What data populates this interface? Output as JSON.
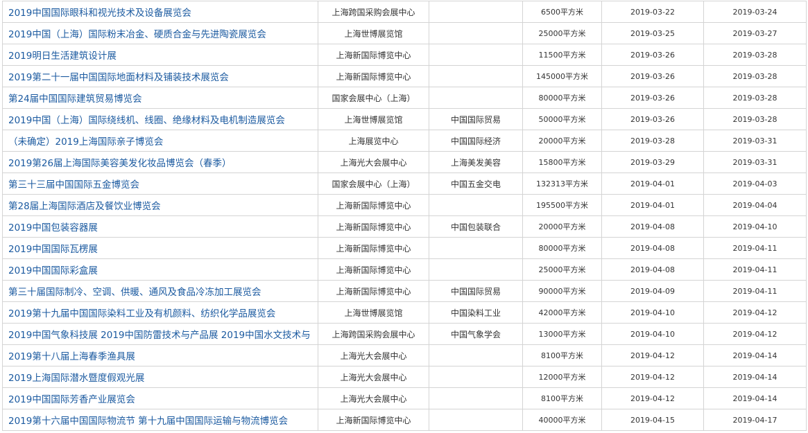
{
  "exhibitions": [
    {
      "name": "2019中国国际眼科和视光技术及设备展览会",
      "venue": "上海跨国采购会展中心",
      "organizer": "",
      "area": "6500平方米",
      "start": "2019-03-22",
      "end": "2019-03-24"
    },
    {
      "name": "2019中国（上海）国际粉末冶金、硬质合金与先进陶瓷展览会",
      "venue": "上海世博展览馆",
      "organizer": "",
      "area": "25000平方米",
      "start": "2019-03-25",
      "end": "2019-03-27"
    },
    {
      "name": "2019明日生活建筑设计展",
      "venue": "上海新国际博览中心",
      "organizer": "",
      "area": "11500平方米",
      "start": "2019-03-26",
      "end": "2019-03-28"
    },
    {
      "name": "2019第二十一届中国国际地面材料及铺装技术展览会",
      "venue": "上海新国际博览中心",
      "organizer": "",
      "area": "145000平方米",
      "start": "2019-03-26",
      "end": "2019-03-28"
    },
    {
      "name": "第24届中国国际建筑贸易博览会",
      "venue": "国家会展中心（上海）",
      "organizer": "",
      "area": "80000平方米",
      "start": "2019-03-26",
      "end": "2019-03-28"
    },
    {
      "name": "2019中国（上海）国际绕线机、线圈、绝缘材料及电机制造展览会",
      "venue": "上海世博展览馆",
      "organizer": "中国国际贸易",
      "area": "50000平方米",
      "start": "2019-03-26",
      "end": "2019-03-28"
    },
    {
      "name": "（未确定）2019上海国际亲子博览会",
      "venue": "上海展览中心",
      "organizer": "中国国际经济",
      "area": "20000平方米",
      "start": "2019-03-28",
      "end": "2019-03-31"
    },
    {
      "name": "2019第26届上海国际美容美发化妆品博览会（春季）",
      "venue": "上海光大会展中心",
      "organizer": "上海美发美容",
      "area": "15800平方米",
      "start": "2019-03-29",
      "end": "2019-03-31"
    },
    {
      "name": "第三十三届中国国际五金博览会",
      "venue": "国家会展中心（上海）",
      "organizer": "中国五金交电",
      "area": "132313平方米",
      "start": "2019-04-01",
      "end": "2019-04-03"
    },
    {
      "name": "第28届上海国际酒店及餐饮业博览会",
      "venue": "上海新国际博览中心",
      "organizer": "",
      "area": "195500平方米",
      "start": "2019-04-01",
      "end": "2019-04-04"
    },
    {
      "name": "2019中国包装容器展",
      "venue": "上海新国际博览中心",
      "organizer": "中国包装联合",
      "area": "20000平方米",
      "start": "2019-04-08",
      "end": "2019-04-10"
    },
    {
      "name": "2019中国国际瓦楞展",
      "venue": "上海新国际博览中心",
      "organizer": "",
      "area": "80000平方米",
      "start": "2019-04-08",
      "end": "2019-04-11"
    },
    {
      "name": "2019中国国际彩盒展",
      "venue": "上海新国际博览中心",
      "organizer": "",
      "area": "25000平方米",
      "start": "2019-04-08",
      "end": "2019-04-11"
    },
    {
      "name": "第三十届国际制冷、空调、供暖、通风及食品冷冻加工展览会",
      "venue": "上海新国际博览中心",
      "organizer": "中国国际贸易",
      "area": "90000平方米",
      "start": "2019-04-09",
      "end": "2019-04-11"
    },
    {
      "name": "2019第十九届中国国际染料工业及有机颜料、纺织化学品展览会",
      "venue": "上海世博展览馆",
      "organizer": "中国染料工业",
      "area": "42000平方米",
      "start": "2019-04-10",
      "end": "2019-04-12"
    },
    {
      "name": "2019中国气象科技展 2019中国防雷技术与产品展 2019中国水文技术与",
      "venue": "上海跨国采购会展中心",
      "organizer": "中国气象学会",
      "area": "13000平方米",
      "start": "2019-04-10",
      "end": "2019-04-12"
    },
    {
      "name": "2019第十八届上海春季渔具展",
      "venue": "上海光大会展中心",
      "organizer": "",
      "area": "8100平方米",
      "start": "2019-04-12",
      "end": "2019-04-14"
    },
    {
      "name": "2019上海国际潜水暨度假观光展",
      "venue": "上海光大会展中心",
      "organizer": "",
      "area": "12000平方米",
      "start": "2019-04-12",
      "end": "2019-04-14"
    },
    {
      "name": "2019中国国际芳香产业展览会",
      "venue": "上海光大会展中心",
      "organizer": "",
      "area": "8100平方米",
      "start": "2019-04-12",
      "end": "2019-04-14"
    },
    {
      "name": "2019第十六届中国国际物流节 第十九届中国国际运输与物流博览会",
      "venue": "上海新国际博览中心",
      "organizer": "",
      "area": "40000平方米",
      "start": "2019-04-15",
      "end": "2019-04-17"
    }
  ]
}
